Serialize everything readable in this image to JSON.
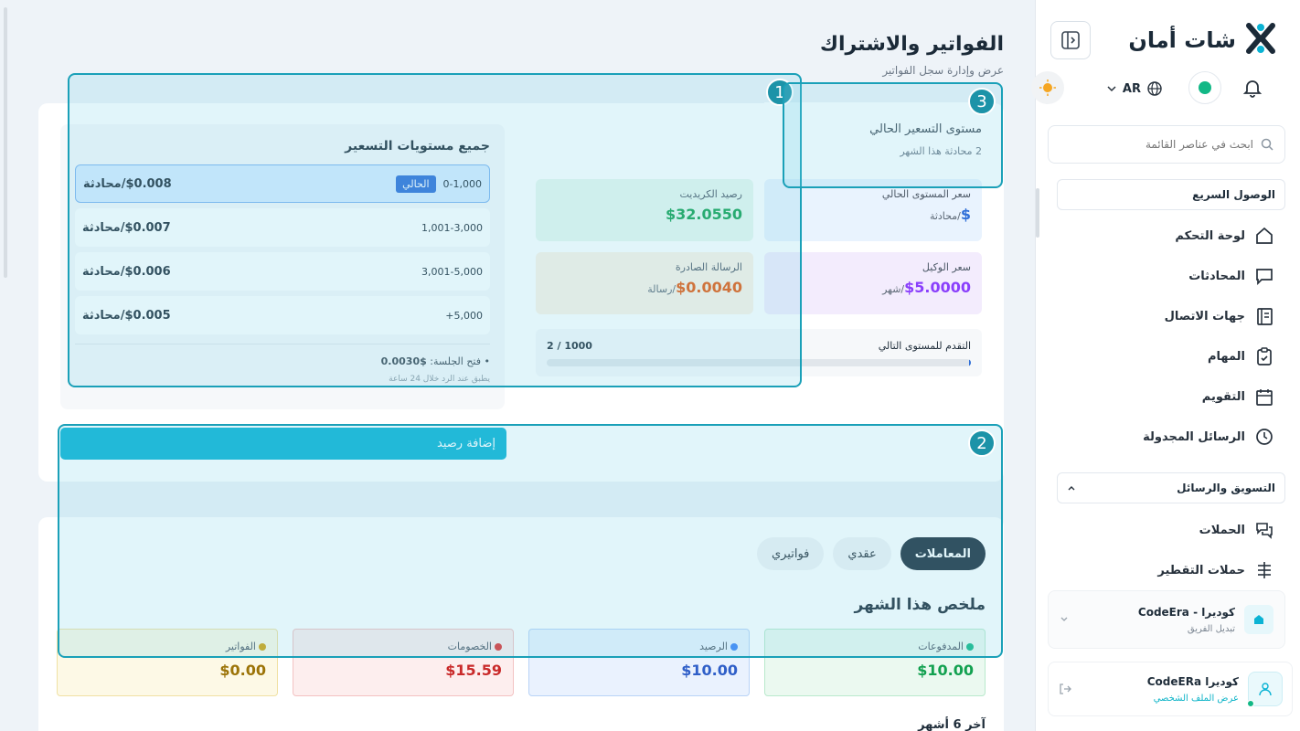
{
  "brand": {
    "name": "شات أمان",
    "logo_color": "#1b2a38",
    "accent": "#0bb3d4"
  },
  "header_controls": {
    "language": "AR",
    "status_color": "#12b886"
  },
  "sidebar": {
    "search_placeholder": "ابحث في عناصر القائمة",
    "quick_access_label": "الوصول السريع",
    "quick_items": [
      {
        "label": "لوحة التحكم",
        "icon": "home-icon"
      },
      {
        "label": "المحادثات",
        "icon": "chat-icon"
      },
      {
        "label": "جهات الاتصال",
        "icon": "contacts-icon"
      },
      {
        "label": "المهام",
        "icon": "tasks-icon"
      },
      {
        "label": "التقويم",
        "icon": "calendar-icon"
      },
      {
        "label": "الرسائل المجدولة",
        "icon": "clock-icon"
      }
    ],
    "marketing_label": "التسويق والرسائل",
    "marketing_items": [
      {
        "label": "الحملات",
        "icon": "campaigns-icon"
      },
      {
        "label": "حملات التقطير",
        "icon": "drip-icon"
      }
    ],
    "team": {
      "name": "كوديرا - CodeEra",
      "sub": "تبديل الفريق"
    },
    "profile": {
      "name": "كوديرا CodeERa",
      "sub": "عرض الملف الشخصي"
    }
  },
  "page": {
    "title": "الفواتير والاشتراك",
    "subtitle": "عرض وإدارة سجل الفواتير"
  },
  "pricing": {
    "current_tier_title": "مستوى التسعير الحالي",
    "current_tier_sub": "2 محادثة هذا الشهر",
    "tiers_title": "جميع مستويات التسعير",
    "current_badge": "الحالي",
    "tiers": [
      {
        "range": "0-1,000",
        "price": "$0.008/محادثة",
        "current": true
      },
      {
        "range": "1,001-3,000",
        "price": "$0.007/محادثة",
        "current": false
      },
      {
        "range": "3,001-5,000",
        "price": "$0.006/محادثة",
        "current": false
      },
      {
        "range": "+5,000",
        "price": "$0.005/محادثة",
        "current": false
      }
    ],
    "session_note_label": "• فتح الجلسة:",
    "session_note_value": "$0.0030",
    "session_note_sub": "يطبق عند الرد خلال 24 ساعة",
    "stats": {
      "tier_price_label": "سعر المستوى الحالي",
      "tier_price_value": "$",
      "tier_price_unit": "/محادثة",
      "credit_label": "رصيد الكريديت",
      "credit_value": "$32.0550",
      "agent_price_label": "سعر الوكيل",
      "agent_price_value": "$5.0000",
      "agent_price_unit": "/شهر",
      "outgoing_label": "الرسالة الصادرة",
      "outgoing_value": "$0.0040",
      "outgoing_unit": "/رسالة"
    },
    "progress_label": "التقدم للمستوى التالي",
    "progress_text": "2 / 1000",
    "progress_fraction": 0.002
  },
  "add_credit_label": "إضافة رصيد",
  "tabs": [
    {
      "label": "المعاملات",
      "active": true
    },
    {
      "label": "عقدي",
      "active": false
    },
    {
      "label": "فواتيري",
      "active": false
    }
  ],
  "summary": {
    "title": "ملخص هذا الشهر",
    "cards": [
      {
        "label": "المدفوعات",
        "value": "$10.00",
        "color": "#12b886"
      },
      {
        "label": "الرصيد",
        "value": "$10.00",
        "color": "#3b82f6"
      },
      {
        "label": "الخصومات",
        "value": "$15.59",
        "color": "#e03131"
      },
      {
        "label": "الفواتير",
        "value": "$0.00",
        "color": "#d4a20b"
      }
    ],
    "last_months": "آخر 6 أشهر"
  },
  "overlays": [
    {
      "number": "3"
    },
    {
      "number": "2"
    },
    {
      "number": "1"
    }
  ]
}
